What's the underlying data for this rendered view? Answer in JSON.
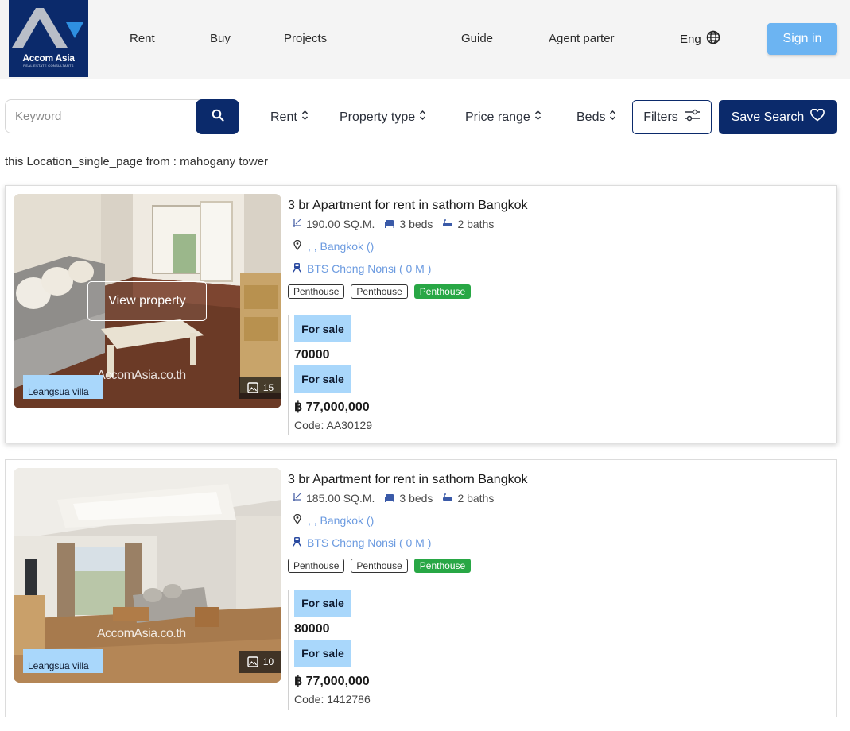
{
  "header": {
    "logo_text": "Accom Asia",
    "logo_sub": "REAL ESTATE CONSULTANTS",
    "nav": [
      {
        "label": "Rent"
      },
      {
        "label": "Buy"
      },
      {
        "label": "Projects"
      },
      {
        "label": "Guide"
      },
      {
        "label": "Agent parter"
      }
    ],
    "language": "Eng",
    "signin_label": "Sign in"
  },
  "search": {
    "placeholder": "Keyword",
    "value": "",
    "dropdowns": [
      {
        "label": "Rent"
      },
      {
        "label": "Property type"
      },
      {
        "label": "Price range"
      },
      {
        "label": "Beds"
      }
    ],
    "filters_label": "Filters",
    "save_label": "Save Search"
  },
  "location_note": "this Location_single_page from : mahogany tower",
  "listings": [
    {
      "title": "3 br Apartment for rent in sathorn Bangkok",
      "area": "190.00 SQ.M.",
      "beds": "3 beds",
      "baths": "2 baths",
      "location": ", , Bangkok ()",
      "transit": "BTS Chong Nonsi ( 0 M )",
      "tags": [
        "Penthouse",
        "Penthouse",
        "Penthouse"
      ],
      "badge_1": "For sale",
      "price_1": "70000",
      "badge_2": "For sale",
      "price_2": "฿ 77,000,000",
      "code": "Code: AA30129",
      "building": "Leangsua villa",
      "photo_count": "15",
      "view_label": "View property",
      "watermark": "AccomAsia.co.th"
    },
    {
      "title": "3 br Apartment for rent in sathorn Bangkok",
      "area": "185.00 SQ.M.",
      "beds": "3 beds",
      "baths": "2 baths",
      "location": ", , Bangkok ()",
      "transit": "BTS Chong Nonsi ( 0 M )",
      "tags": [
        "Penthouse",
        "Penthouse",
        "Penthouse"
      ],
      "badge_1": "For sale",
      "price_1": "80000",
      "badge_2": "For sale",
      "price_2": "฿ 77,000,000",
      "code": "Code: 1412786",
      "building": "Leangsua villa",
      "photo_count": "10",
      "watermark": "AccomAsia.co.th"
    }
  ],
  "colors": {
    "brand_navy": "#0b2a6b",
    "signin_blue": "#6cb4f2",
    "badge_blue": "#a9d7fb",
    "link_blue": "#6c9be0",
    "tag_green": "#28a745"
  }
}
